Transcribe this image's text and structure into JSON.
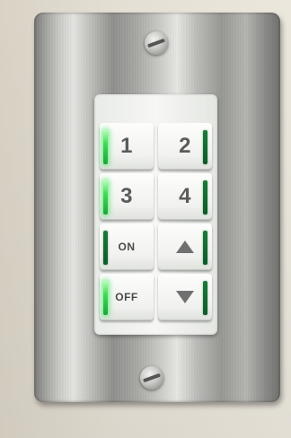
{
  "keypad": {
    "keys": [
      {
        "label": "1",
        "led": "on"
      },
      {
        "label": "2",
        "led": "dim"
      },
      {
        "label": "3",
        "led": "on"
      },
      {
        "label": "4",
        "led": "dim"
      },
      {
        "label": "ON",
        "led": "dim"
      },
      {
        "icon": "up-arrow-icon",
        "led": "dim"
      },
      {
        "label": "OFF",
        "led": "on"
      },
      {
        "icon": "down-arrow-icon",
        "led": "dim"
      }
    ]
  },
  "colors": {
    "led_on": "#3ddc54",
    "led_dim": "#0e5a28",
    "plate": "#b9b9b6",
    "keypad": "#f6f7f4"
  }
}
